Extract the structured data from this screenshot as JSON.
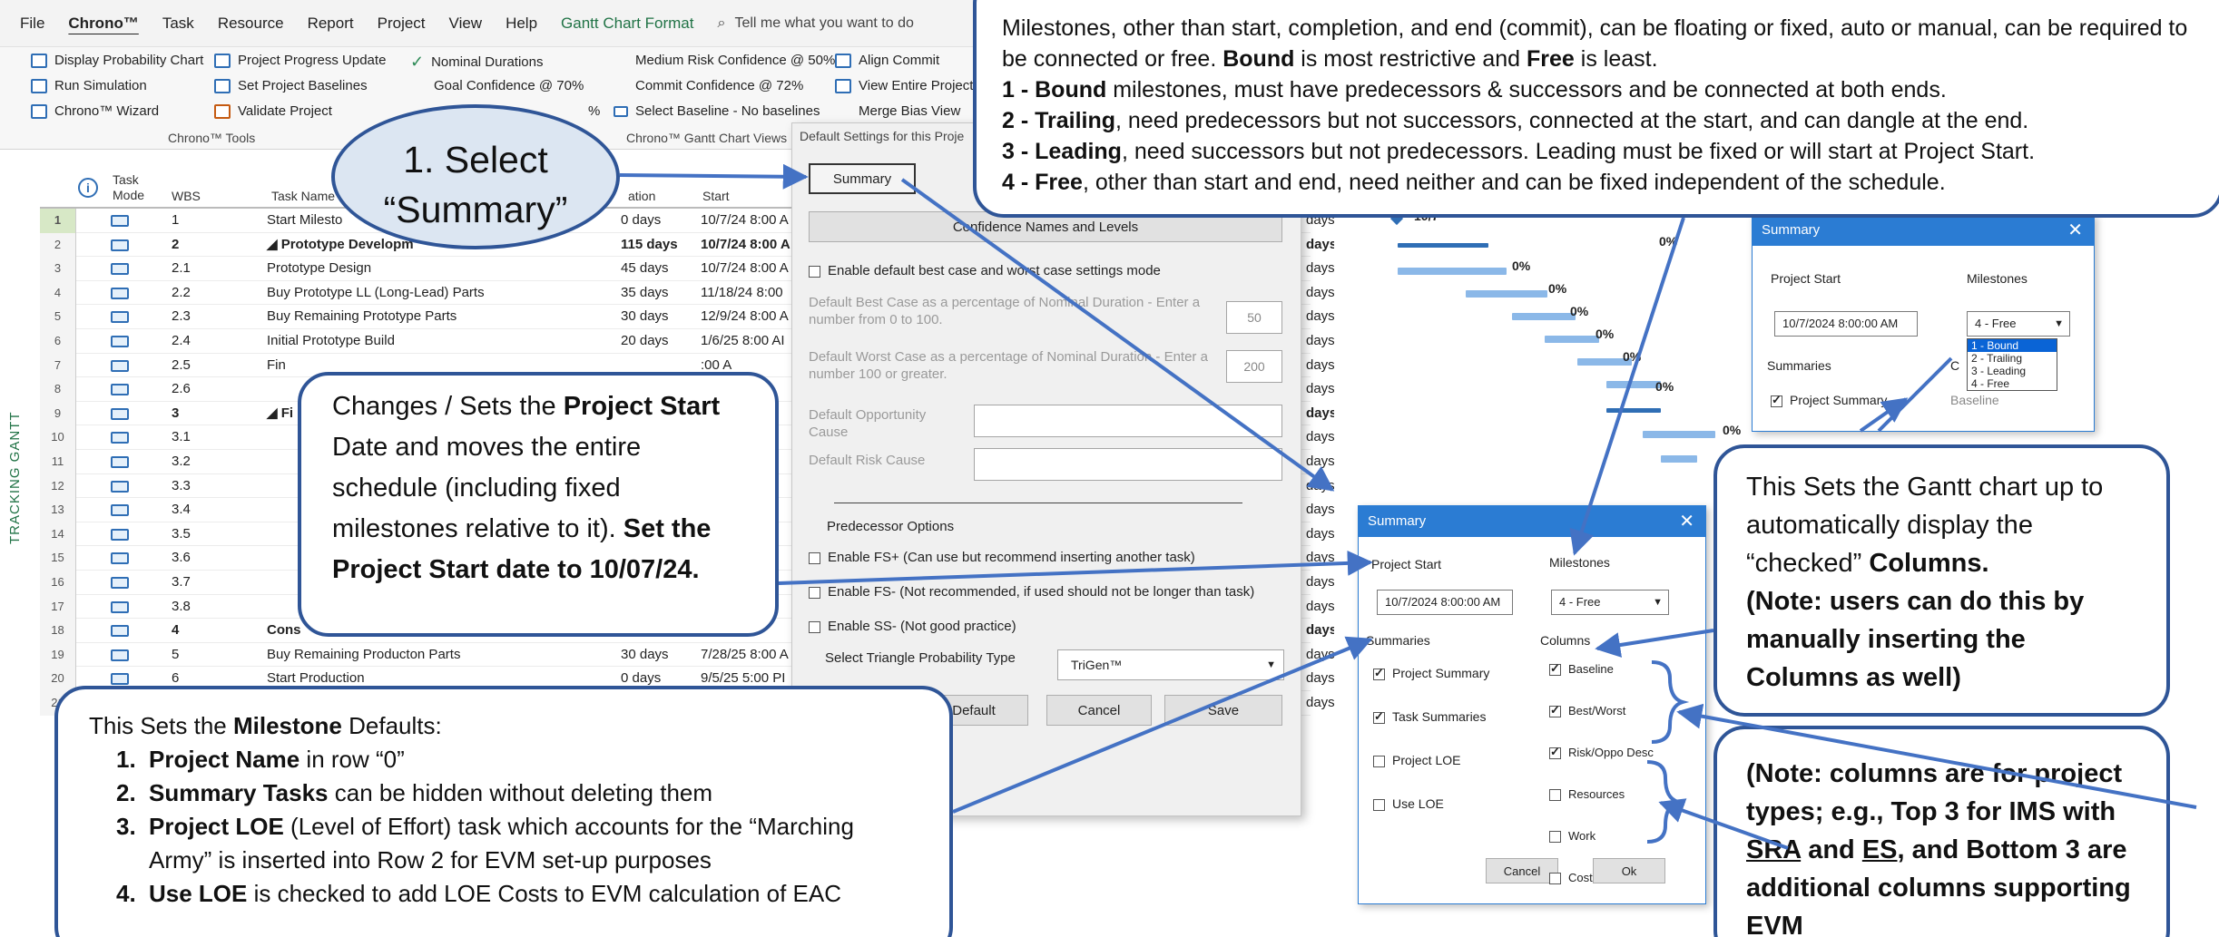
{
  "menu": {
    "items": [
      "File",
      "Chrono™",
      "Task",
      "Resource",
      "Report",
      "Project",
      "View",
      "Help",
      "Gantt Chart Format"
    ],
    "tell_me": "Tell me what you want to do"
  },
  "ribbon": {
    "col1": [
      "Display Probability Chart",
      "Run Simulation",
      "Chrono™ Wizard"
    ],
    "col2": [
      "Project Progress Update",
      "Set Project Baselines",
      "Validate Project"
    ],
    "col3": [
      "Nominal Durations",
      "Goal Confidence @ 70%"
    ],
    "col4": [
      "Medium Risk Confidence @ 50%",
      "Commit Confidence @ 72%",
      "Select Baseline - No baselines"
    ],
    "col5": [
      "Align Commit",
      "View Entire Project",
      "Merge Bias View"
    ],
    "group_tools": "Chrono™ Tools",
    "group_views": "Chrono™ Gantt Chart Views",
    "pct_fragment": "%"
  },
  "grid": {
    "vertical_label": "TRACKING GANTT",
    "headers": {
      "mode": "Task Mode",
      "wbs": "WBS",
      "name": "Task Name",
      "duration": "Duration",
      "start": "Start"
    },
    "duration_header_fragment": "ation",
    "rows": [
      {
        "n": "1",
        "wbs": "1",
        "name": "Start Milesto",
        "dur": "0 days",
        "start": "10/7/24 8:00 A",
        "d": "days",
        "bold": false,
        "sel": true
      },
      {
        "n": "2",
        "wbs": "2",
        "name": "◢ Prototype Developm",
        "dur": "115 days",
        "start": "10/7/24 8:00 A",
        "d": "days",
        "bold": true
      },
      {
        "n": "3",
        "wbs": "2.1",
        "name": "Prototype Design",
        "dur": "45 days",
        "start": "10/7/24 8:00 A",
        "d": "days"
      },
      {
        "n": "4",
        "wbs": "2.2",
        "name": "Buy Prototype LL (Long-Lead) Parts",
        "dur": "35 days",
        "start": "11/18/24 8:00",
        "d": "days"
      },
      {
        "n": "5",
        "wbs": "2.3",
        "name": "Buy Remaining Prototype Parts",
        "dur": "30 days",
        "start": "12/9/24 8:00 A",
        "d": "days"
      },
      {
        "n": "6",
        "wbs": "2.4",
        "name": "Initial Prototype Build",
        "dur": "20 days",
        "start": "1/6/25 8:00 AI",
        "d": "days"
      },
      {
        "n": "7",
        "wbs": "2.5",
        "name": "Fin",
        "dur": "",
        "start": ":00 A",
        "d": "days"
      },
      {
        "n": "8",
        "wbs": "2.6",
        "name": "",
        "dur": "",
        "start": "",
        "d": "days"
      },
      {
        "n": "9",
        "wbs": "3",
        "name": "◢ Fi",
        "dur": "",
        "start": "",
        "d": "days",
        "bold": true
      },
      {
        "n": "10",
        "wbs": "3.1",
        "name": "",
        "dur": "",
        "start": "",
        "d": "days"
      },
      {
        "n": "11",
        "wbs": "3.2",
        "name": "",
        "dur": "",
        "start": "",
        "d": "days"
      },
      {
        "n": "12",
        "wbs": "3.3",
        "name": "",
        "dur": "",
        "start": "",
        "d": "days"
      },
      {
        "n": "13",
        "wbs": "3.4",
        "name": "",
        "dur": "",
        "start": "",
        "d": "days"
      },
      {
        "n": "14",
        "wbs": "3.5",
        "name": "",
        "dur": "",
        "start": "",
        "d": "days"
      },
      {
        "n": "15",
        "wbs": "3.6",
        "name": "",
        "dur": "",
        "start": "",
        "d": "days"
      },
      {
        "n": "16",
        "wbs": "3.7",
        "name": "",
        "dur": "",
        "start": "",
        "d": "days"
      },
      {
        "n": "17",
        "wbs": "3.8",
        "name": "",
        "dur": "",
        "start": "",
        "d": "days"
      },
      {
        "n": "18",
        "wbs": "4",
        "name": "Cons",
        "dur": "",
        "start": "0 PI",
        "d": "days",
        "bold": true
      },
      {
        "n": "19",
        "wbs": "5",
        "name": "Buy Remaining Producton Parts",
        "dur": "30 days",
        "start": "7/28/25 8:00 A",
        "d": "days"
      },
      {
        "n": "20",
        "wbs": "6",
        "name": "Start Production",
        "dur": "0 days",
        "start": "9/5/25 5:00 PI",
        "d": "days"
      },
      {
        "n": "21",
        "wbs": "",
        "name": "",
        "dur": "",
        "start": "",
        "d": "days"
      }
    ]
  },
  "gantt": {
    "date_fragment": "10/7",
    "pct": [
      "0%",
      "0%",
      "0%",
      "0%",
      "0%",
      "0%",
      "0%",
      "0%"
    ],
    "top_right_pct": "0%"
  },
  "default_dialog": {
    "title": "Default Settings for this Proje",
    "summary_btn": "Summary",
    "confidence_btn": "Confidence Names and Levels",
    "enable_default": "Enable default best case and worst case settings mode",
    "best_case_label": "Default Best Case as a percentage of Nominal Duration - Enter a number from 0 to 100.",
    "best_case_value": "50",
    "worst_case_label": "Default Worst Case as a percentage of Nominal Duration - Enter a number 100 or greater.",
    "worst_case_value": "200",
    "opportunity_label": "Default Opportunity Cause",
    "risk_label": "Default Risk Cause",
    "predecessor_title": "Predecessor Options",
    "fs_plus": "Enable FS+ (Can use but recommend inserting another task)",
    "fs_minus": "Enable FS-  (Not recommended, if used should not be longer than task)",
    "ss_minus": "Enable SS-  (Not good practice)",
    "triangle_label": "Select Triangle Probability Type",
    "triangle_value": "TriGen™",
    "btn_default": "Default",
    "btn_cancel": "Cancel",
    "btn_save": "Save"
  },
  "summary_dialog": {
    "title": "Summary",
    "project_start_label": "Project Start",
    "project_start_value": "10/7/2024 8:00:00 AM",
    "milestones_label": "Milestones",
    "milestones_value": "4 - Free",
    "summaries_label": "Summaries",
    "columns_label": "Columns",
    "summaries": [
      "Project Summary",
      "Task Summaries",
      "Project LOE",
      "Use LOE"
    ],
    "summaries_checked": [
      true,
      true,
      false,
      false
    ],
    "columns": [
      "Baseline",
      "Best/Worst",
      "Risk/Oppo Desc",
      "Resources",
      "Work",
      "Cost"
    ],
    "columns_checked": [
      true,
      true,
      true,
      false,
      false,
      false
    ],
    "btn_cancel": "Cancel",
    "btn_ok": "Ok"
  },
  "summary_small": {
    "title": "Summary",
    "project_start_label": "Project Start",
    "project_start_value": "10/7/2024 8:00:00 AM",
    "milestones_label": "Milestones",
    "milestones_value": "4 - Free",
    "options": [
      "1 - Bound",
      "2 - Trailing",
      "3 - Leading",
      "4 - Free"
    ],
    "summaries_label": "Summaries",
    "project_summary": "Project Summary",
    "columns_fragment": "C",
    "baseline_fragment": "Baseline"
  },
  "callouts": {
    "select_summary": [
      "1. Select",
      "“Summary”"
    ],
    "project_start": {
      "t1": "Changes / Sets the ",
      "t1b": "Project Start",
      "t2": " Date and moves the entire schedule (including fixed milestones relative to it). ",
      "t3b": "Set the Project Start date to 10/07/24."
    },
    "milestone_defaults": {
      "intro": "This Sets the ",
      "intro_b": "Milestone",
      "intro_end": " Defaults:",
      "items": [
        {
          "num": "1.",
          "b": "Project Name",
          "t": " in row “0”"
        },
        {
          "num": "2.",
          "b": "Summary Tasks",
          "t": " can be hidden without deleting them"
        },
        {
          "num": "3.",
          "b": "Project LOE",
          "t": " (Level of Effort) task which accounts for the “Marching Army” is inserted into Row 2 for EVM set-up purposes"
        },
        {
          "num": "4.",
          "b": "Use LOE",
          "t": " is checked to add LOE Costs to EVM calculation of EAC"
        }
      ]
    },
    "milestones_info": {
      "p1": "Milestones, other than start, completion, and end (commit), can be floating or fixed, auto or manual, can be required to be connected or free.  ",
      "p1b1": "Bound",
      "p1m": " is most restrictive and ",
      "p1b2": "Free",
      "p1e": " is least.",
      "l1b": "1 - Bound",
      "l1": " milestones, must have predecessors & successors and be connected at both ends.",
      "l2b": "2 - Trailing",
      "l2": ", need predecessors but not successors, connected at the start, and can dangle at the end.",
      "l3b": "3 - Leading",
      "l3": ", need successors but not predecessors.  Leading must be fixed or will start at Project Start.",
      "l4b": "4 - Free",
      "l4": ", other than start and end, need neither and can be fixed independent of the schedule."
    },
    "gantt_columns": {
      "t1": "This Sets the Gantt chart up to automatically display the “checked” ",
      "t1b": "Columns.",
      "t2b": "(Note: users can do this by manually inserting the Columns as well)"
    },
    "columns_note": {
      "t1": "(Note: columns are for project types; e.g., Top 3 for IMS with ",
      "u1": "SRA",
      "t2": " and ",
      "u2": "ES",
      "t3": ", and Bottom 3 are additional columns supporting EVM"
    }
  }
}
